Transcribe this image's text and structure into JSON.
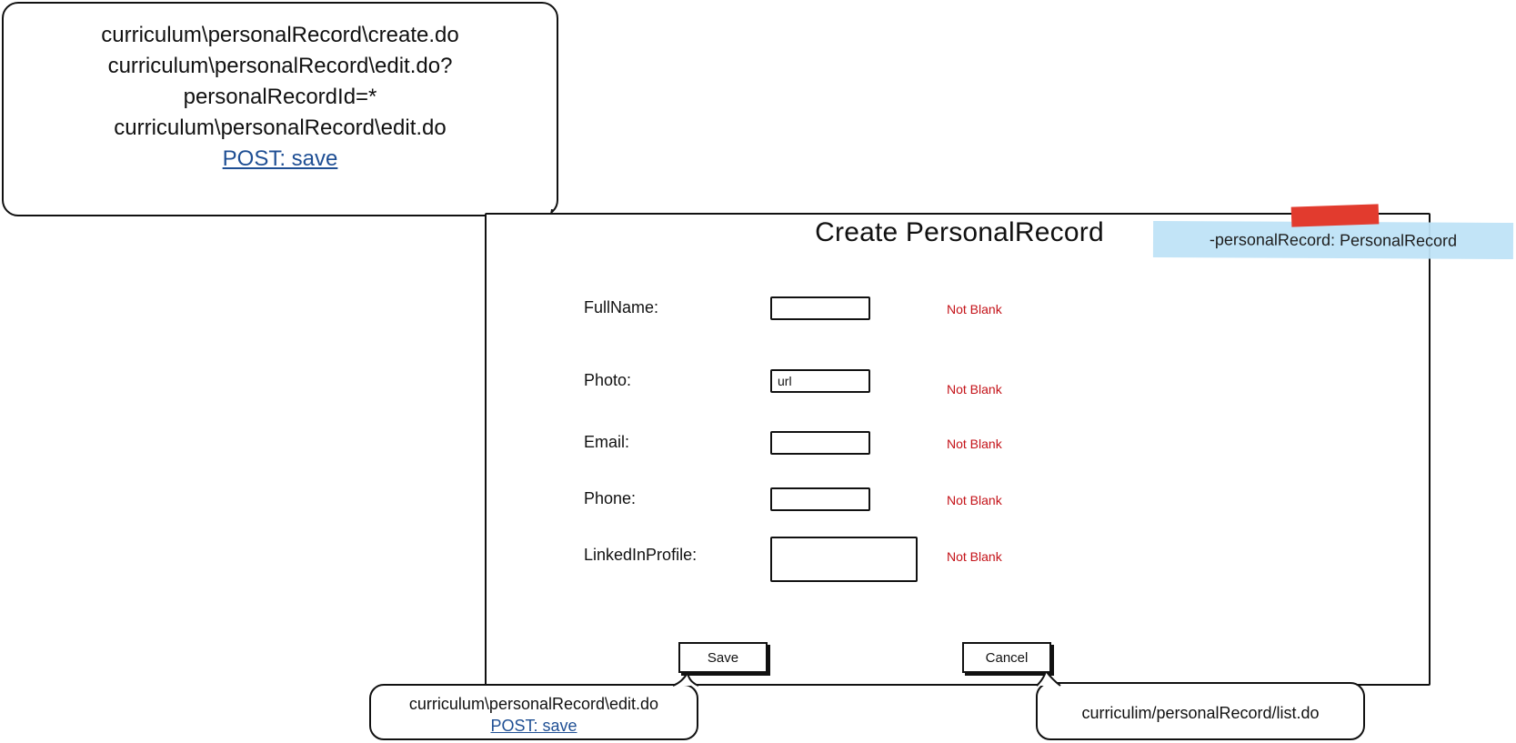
{
  "form": {
    "title": "Create PersonalRecord",
    "model_note": "-personalRecord: PersonalRecord",
    "fields": [
      {
        "label": "FullName:",
        "value": "",
        "error": "Not Blank"
      },
      {
        "label": "Photo:",
        "value": "url",
        "error": "Not Blank"
      },
      {
        "label": "Email:",
        "value": "",
        "error": "Not Blank"
      },
      {
        "label": "Phone:",
        "value": "",
        "error": "Not Blank"
      },
      {
        "label": "LinkedInProfile:",
        "value": "",
        "error": "Not Blank"
      }
    ],
    "buttons": {
      "save": "Save",
      "cancel": "Cancel"
    }
  },
  "callouts": {
    "main": {
      "lines": [
        "curriculum\\personalRecord\\create.do",
        "curriculum\\personalRecord\\edit.do?",
        "personalRecordId=*",
        "curriculum\\personalRecord\\edit.do"
      ],
      "link": "POST: save"
    },
    "save": {
      "line": "curriculum\\personalRecord\\edit.do",
      "link": "POST: save"
    },
    "cancel": {
      "line": "curriculim/personalRecord/list.do"
    }
  }
}
